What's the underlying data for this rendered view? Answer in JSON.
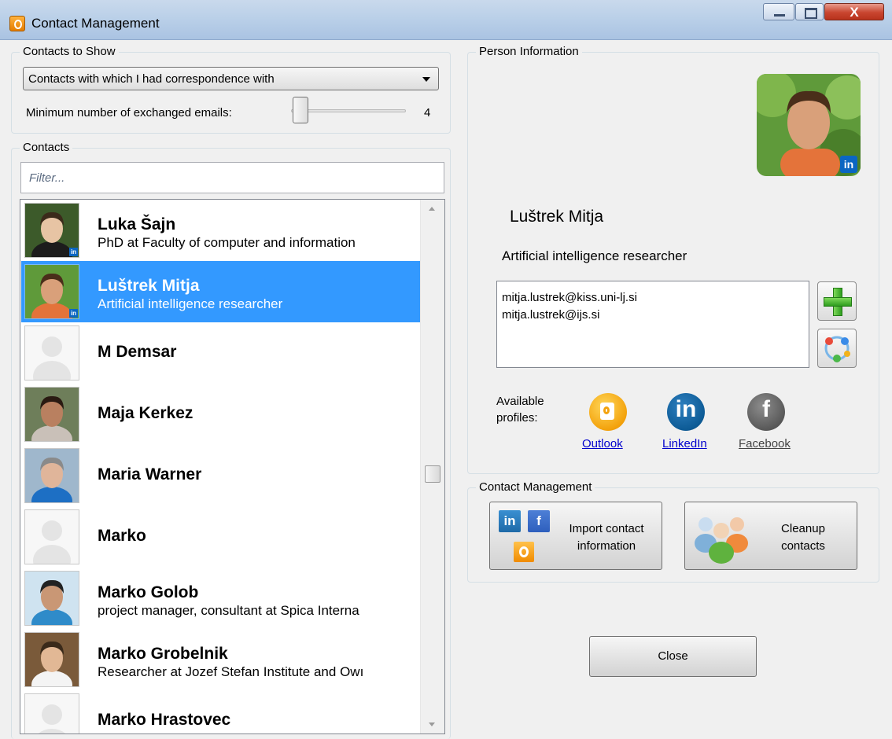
{
  "window": {
    "title": "Contact Management",
    "close_glyph": "X"
  },
  "contacts_to_show": {
    "group_title": "Contacts to Show",
    "selected_option": "Contacts with which I had correspondence with",
    "min_emails_label": "Minimum number of exchanged emails:",
    "min_emails_value": "4"
  },
  "contacts": {
    "group_title": "Contacts",
    "filter_placeholder": "Filter...",
    "items": [
      {
        "name": "Luka Šajn",
        "subtitle": "PhD at Faculty of computer and information",
        "photo": "photo",
        "linkedin_badge": true
      },
      {
        "name": "Luštrek Mitja",
        "subtitle": "Artificial intelligence researcher",
        "photo": "photo",
        "linkedin_badge": true,
        "selected": true
      },
      {
        "name": "M Demsar",
        "subtitle": "",
        "photo": "placeholder"
      },
      {
        "name": "Maja Kerkez",
        "subtitle": "",
        "photo": "photo"
      },
      {
        "name": "Maria Warner",
        "subtitle": "",
        "photo": "photo"
      },
      {
        "name": "Marko",
        "subtitle": "",
        "photo": "placeholder"
      },
      {
        "name": "Marko Golob",
        "subtitle": "project manager, consultant at Spica Interna",
        "photo": "photo"
      },
      {
        "name": "Marko Grobelnik",
        "subtitle": "Researcher at Jozef Stefan Institute and Owı",
        "photo": "photo"
      },
      {
        "name": "Marko Hrastovec",
        "subtitle": "",
        "photo": "placeholder"
      }
    ]
  },
  "person": {
    "group_title": "Person Information",
    "name": "Luštrek Mitja",
    "title": "Artificial intelligence researcher",
    "emails": [
      "mitja.lustrek@kiss.uni-lj.si",
      "mitja.lustrek@ijs.si"
    ],
    "available_profiles_label": "Available profiles:",
    "profiles": {
      "outlook": "Outlook",
      "linkedin": "LinkedIn",
      "facebook": "Facebook"
    },
    "linkedin_badge": "in"
  },
  "management": {
    "group_title": "Contact Management",
    "import_label": "Import contact information",
    "cleanup_label": "Cleanup contacts",
    "li_icon": "in",
    "fb_icon": "f"
  },
  "close_label": "Close",
  "colors": {
    "selection": "#3399ff",
    "link": "#0000cc"
  }
}
